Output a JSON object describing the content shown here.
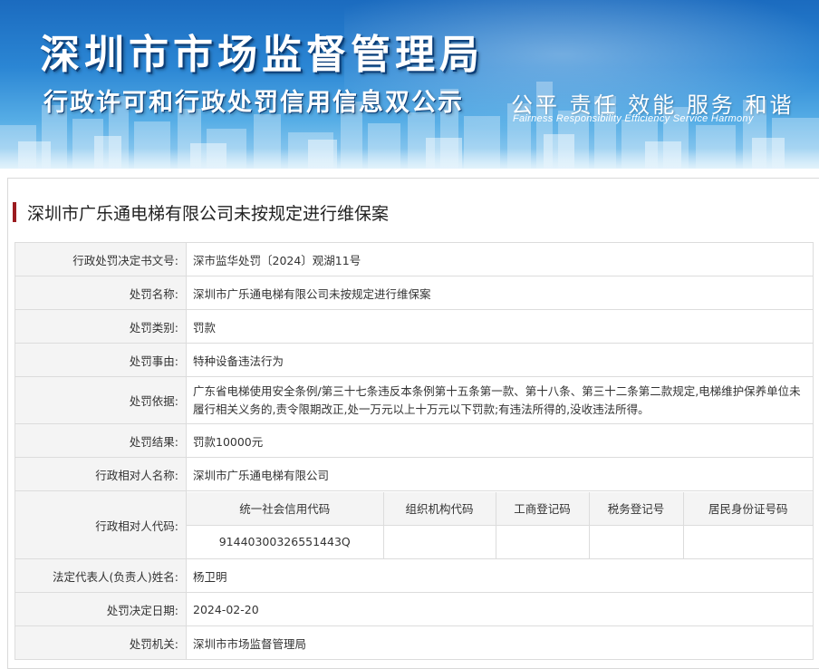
{
  "banner": {
    "title": "深圳市市场监督管理局",
    "subtitle": "行政许可和行政处罚信用信息双公示",
    "slogan": "公平 责任 效能 服务 和谐",
    "slogan_en": "Fairness Responsibility Efficiency Service Harmony"
  },
  "case_title": "深圳市广乐通电梯有限公司未按规定进行维保案",
  "rows": {
    "doc_no": {
      "label": "行政处罚决定书文号:",
      "value": "深市监华处罚〔2024〕观湖11号"
    },
    "penalty_name": {
      "label": "处罚名称:",
      "value": "深圳市广乐通电梯有限公司未按规定进行维保案"
    },
    "penalty_type": {
      "label": "处罚类别:",
      "value": "罚款"
    },
    "penalty_reason": {
      "label": "处罚事由:",
      "value": "特种设备违法行为"
    },
    "penalty_basis": {
      "label": "处罚依据:",
      "value": "广东省电梯使用安全条例/第三十七条违反本条例第十五条第一款、第十八条、第三十二条第二款规定,电梯维护保养单位未履行相关义务的,责令限期改正,处一万元以上十万元以下罚款;有违法所得的,没收违法所得。"
    },
    "penalty_result": {
      "label": "处罚结果:",
      "value": "罚款10000元"
    },
    "party_name": {
      "label": "行政相对人名称:",
      "value": "深圳市广乐通电梯有限公司"
    },
    "party_code": {
      "label": "行政相对人代码:",
      "headers": [
        "统一社会信用代码",
        "组织机构代码",
        "工商登记码",
        "税务登记号",
        "居民身份证号码"
      ],
      "values": [
        "91440300326551443Q",
        "",
        "",
        "",
        ""
      ]
    },
    "legal_rep": {
      "label": "法定代表人(负责人)姓名:",
      "value": "杨卫明"
    },
    "decision_date": {
      "label": "处罚决定日期:",
      "value": "2024-02-20"
    },
    "authority": {
      "label": "处罚机关:",
      "value": "深圳市市场监督管理局"
    }
  },
  "colors": {
    "accent_bar": "#9b1b20",
    "banner_top": "#1b6bbf",
    "label_bg": "#f4f4f4",
    "border": "#dcdcdc"
  }
}
